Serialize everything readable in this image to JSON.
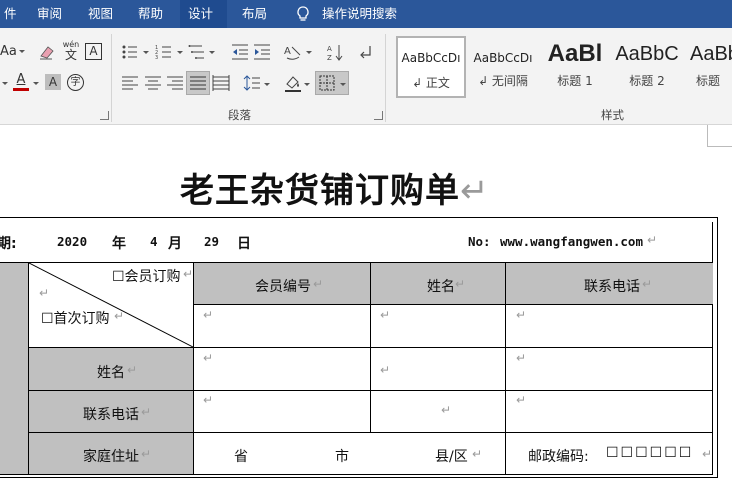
{
  "tabs": [
    {
      "label": "件",
      "active": false
    },
    {
      "label": "审阅",
      "active": false
    },
    {
      "label": "视图",
      "active": false
    },
    {
      "label": "帮助",
      "active": false
    },
    {
      "label": "设计",
      "active": true
    },
    {
      "label": "布局",
      "active": false
    },
    {
      "label": "操作说明搜索",
      "active": false
    }
  ],
  "ribbon": {
    "font_row1": {
      "aa": "Aa",
      "wen_top": "wén",
      "wen_char": "文",
      "boxed": "A"
    },
    "font_row2": {
      "font_color_letter": "A",
      "shade_letter": "A",
      "circle_char": "字"
    },
    "paragraph_label": "段落",
    "styles_label": "样式",
    "styles": [
      {
        "preview": "AaBbCcDı",
        "name": "↲ 正文",
        "selected": true
      },
      {
        "preview": "AaBbCcDı",
        "name": "↲ 无间隔",
        "selected": false
      },
      {
        "preview": "AaBl",
        "name": "标题 1",
        "selected": false
      },
      {
        "preview": "AaBbC",
        "name": "标题 2",
        "selected": false
      },
      {
        "preview": "AaBb",
        "name": "标题",
        "selected": false
      }
    ],
    "colors": {
      "font_color": "#c00000",
      "accent": "#2b579a"
    }
  },
  "document": {
    "title": "老王杂货铺订购单",
    "paragraph_mark": "↵",
    "date_row": {
      "label": "期:",
      "year": "2020",
      "year_unit": "年",
      "month": "4",
      "month_unit": "月",
      "day": "29",
      "day_unit": "日",
      "no_label": "No:",
      "website": "www.wangfangwen.com"
    },
    "diag_cell": {
      "top": "☐会员订购",
      "bottom": "☐首次订购"
    },
    "headers": {
      "member_no": "会员编号",
      "name": "姓名",
      "phone": "联系电话"
    },
    "row_labels": {
      "name": "姓名",
      "phone": "联系电话",
      "address": "家庭住址"
    },
    "address": {
      "province": "省",
      "city": "市",
      "county": "县/区",
      "postcode_label": "邮政编码:",
      "postcode_boxes": "☐☐☐☐☐☐"
    }
  }
}
